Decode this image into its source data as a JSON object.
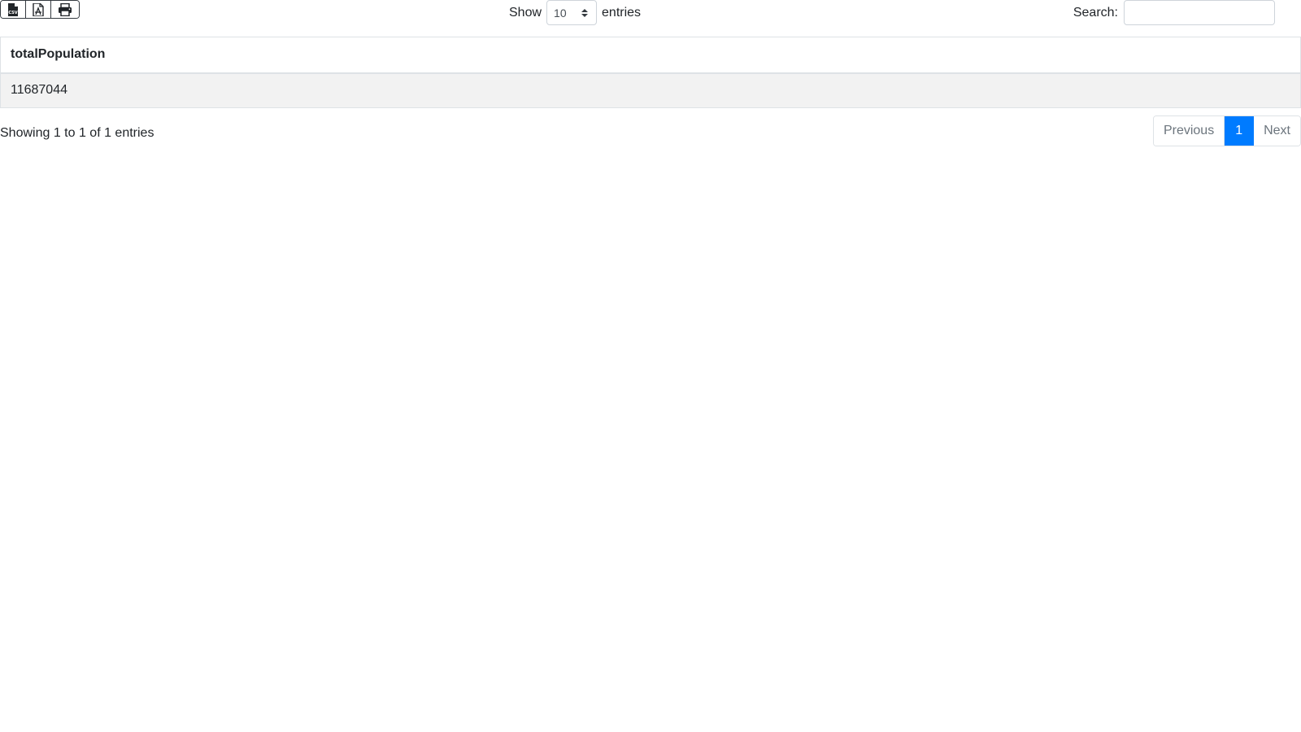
{
  "toolbar": {
    "export_buttons": [
      {
        "name": "csv-export-button",
        "icon": "csv-file-icon"
      },
      {
        "name": "pdf-export-button",
        "icon": "pdf-file-icon"
      },
      {
        "name": "print-button",
        "icon": "printer-icon"
      }
    ],
    "length": {
      "label_before": "Show",
      "selected": "10",
      "label_after": "entries"
    },
    "search": {
      "label": "Search:",
      "value": "",
      "placeholder": ""
    }
  },
  "table": {
    "columns": [
      "totalPopulation"
    ],
    "rows": [
      [
        "11687044"
      ]
    ]
  },
  "footer": {
    "info": "Showing 1 to 1 of 1 entries",
    "pagination": {
      "previous": "Previous",
      "current": "1",
      "next": "Next"
    }
  },
  "colors": {
    "accent": "#007bff",
    "row_stripe": "#f2f2f2",
    "border": "#dee2e6"
  }
}
